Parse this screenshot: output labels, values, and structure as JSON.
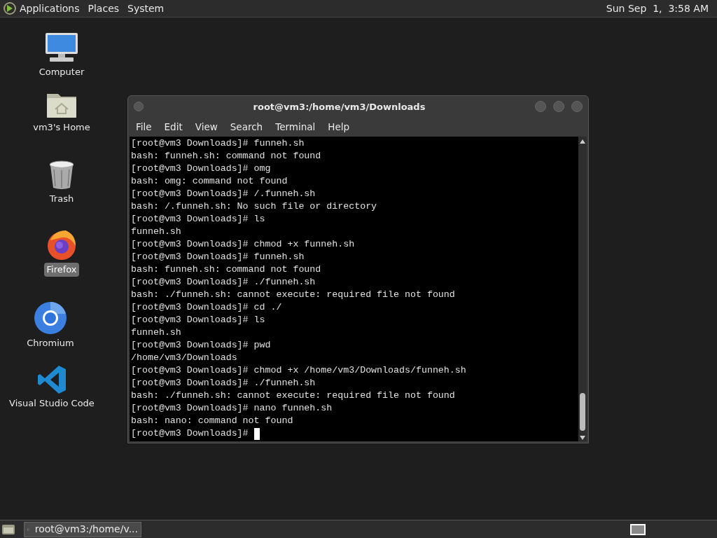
{
  "top_panel": {
    "menus": [
      "Applications",
      "Places",
      "System"
    ],
    "clock": "Sun Sep  1,  3:58 AM"
  },
  "desktop_icons": [
    {
      "kind": "computer",
      "label": "Computer",
      "selected": false
    },
    {
      "kind": "home",
      "label": "vm3's Home",
      "selected": false
    },
    {
      "kind": "trash",
      "label": "Trash",
      "selected": false
    },
    {
      "kind": "firefox",
      "label": "Firefox",
      "selected": true
    },
    {
      "kind": "chromium",
      "label": "Chromium",
      "selected": false
    },
    {
      "kind": "vscode",
      "label": "Visual Studio Code",
      "selected": false
    }
  ],
  "terminal": {
    "title": "root@vm3:/home/vm3/Downloads",
    "menu": [
      "File",
      "Edit",
      "View",
      "Search",
      "Terminal",
      "Help"
    ],
    "lines": [
      "[root@vm3 Downloads]# funneh.sh",
      "bash: funneh.sh: command not found",
      "[root@vm3 Downloads]# omg",
      "bash: omg: command not found",
      "[root@vm3 Downloads]# /.funneh.sh",
      "bash: /.funneh.sh: No such file or directory",
      "[root@vm3 Downloads]# ls",
      "funneh.sh",
      "[root@vm3 Downloads]# chmod +x funneh.sh",
      "[root@vm3 Downloads]# funneh.sh",
      "bash: funneh.sh: command not found",
      "[root@vm3 Downloads]# ./funneh.sh",
      "bash: ./funneh.sh: cannot execute: required file not found",
      "[root@vm3 Downloads]# cd ./",
      "[root@vm3 Downloads]# ls",
      "funneh.sh",
      "[root@vm3 Downloads]# pwd",
      "/home/vm3/Downloads",
      "[root@vm3 Downloads]# chmod +x /home/vm3/Downloads/funneh.sh",
      "[root@vm3 Downloads]# ./funneh.sh",
      "bash: ./funneh.sh: cannot execute: required file not found",
      "[root@vm3 Downloads]# nano funneh.sh",
      "bash: nano: command not found",
      "[root@vm3 Downloads]# "
    ]
  },
  "taskbar": {
    "tasks": [
      {
        "label": "root@vm3:/home/v...",
        "selected": true
      }
    ]
  }
}
